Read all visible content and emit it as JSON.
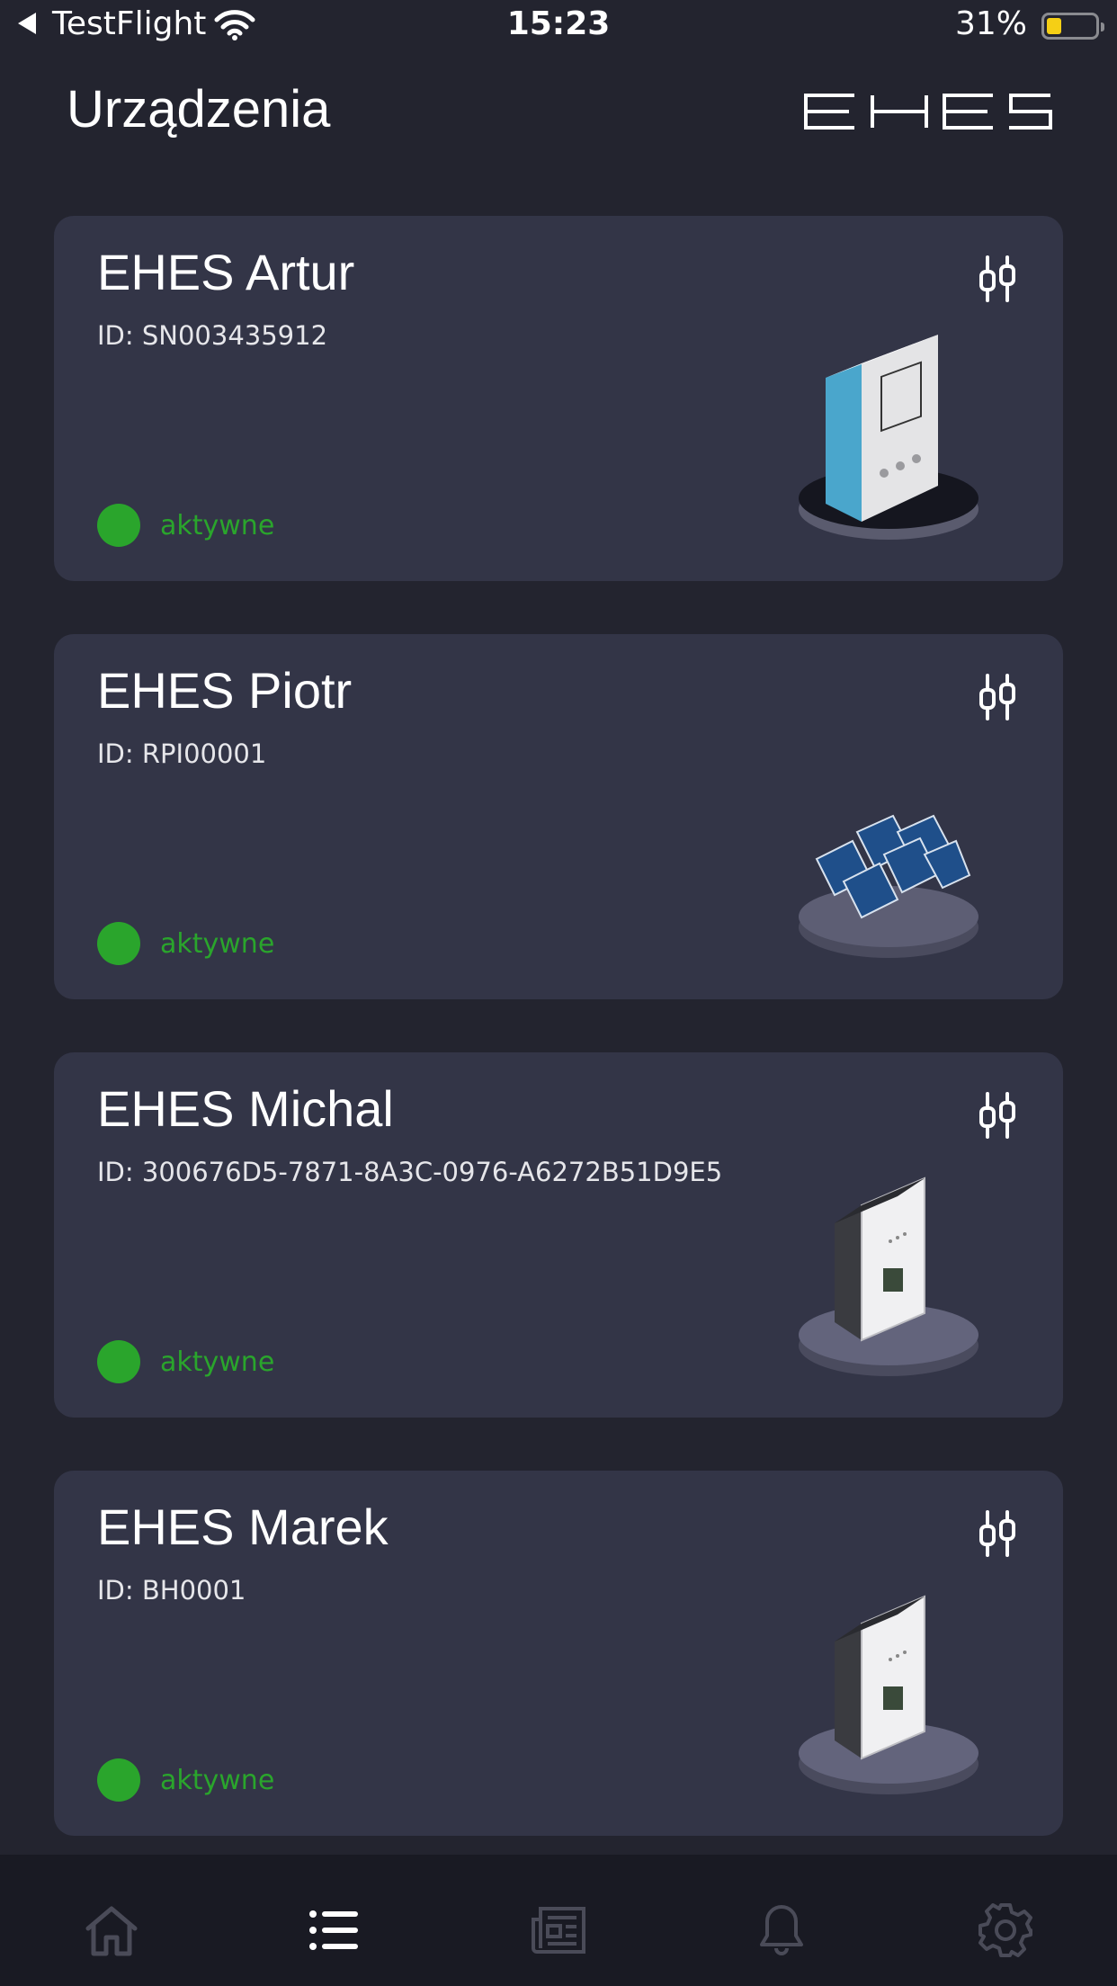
{
  "status_bar": {
    "back_app": "TestFlight",
    "time": "15:23",
    "battery_percent": "31%",
    "battery_level": 0.31,
    "battery_color": "#f5cf15"
  },
  "header": {
    "title": "Urządzenia",
    "logo_text": "EHES"
  },
  "devices": [
    {
      "name": "EHES Artur",
      "id_label": "ID: SN003435912",
      "status": "aktywne",
      "image": "inverter-box-icon"
    },
    {
      "name": "EHES Piotr",
      "id_label": "ID: RPI00001",
      "status": "aktywne",
      "image": "solar-panels-icon"
    },
    {
      "name": "EHES Michal",
      "id_label": "ID: 300676D5-7871-8A3C-0976-A6272B51D9E5",
      "status": "aktywne",
      "image": "wall-inverter-icon"
    },
    {
      "name": "EHES Marek",
      "id_label": "ID: BH0001",
      "status": "aktywne",
      "image": "wall-inverter-icon"
    }
  ],
  "tab_bar": {
    "tabs": [
      {
        "icon": "home-icon",
        "active": false
      },
      {
        "icon": "list-icon",
        "active": true
      },
      {
        "icon": "news-icon",
        "active": false
      },
      {
        "icon": "bell-icon",
        "active": false
      },
      {
        "icon": "gear-icon",
        "active": false
      }
    ]
  },
  "colors": {
    "background": "#23242f",
    "card": "#333547",
    "status_active": "#2aa52c",
    "tabbar": "#191a23",
    "tab_inactive": "#4a4b58",
    "tab_active": "#ffffff"
  }
}
